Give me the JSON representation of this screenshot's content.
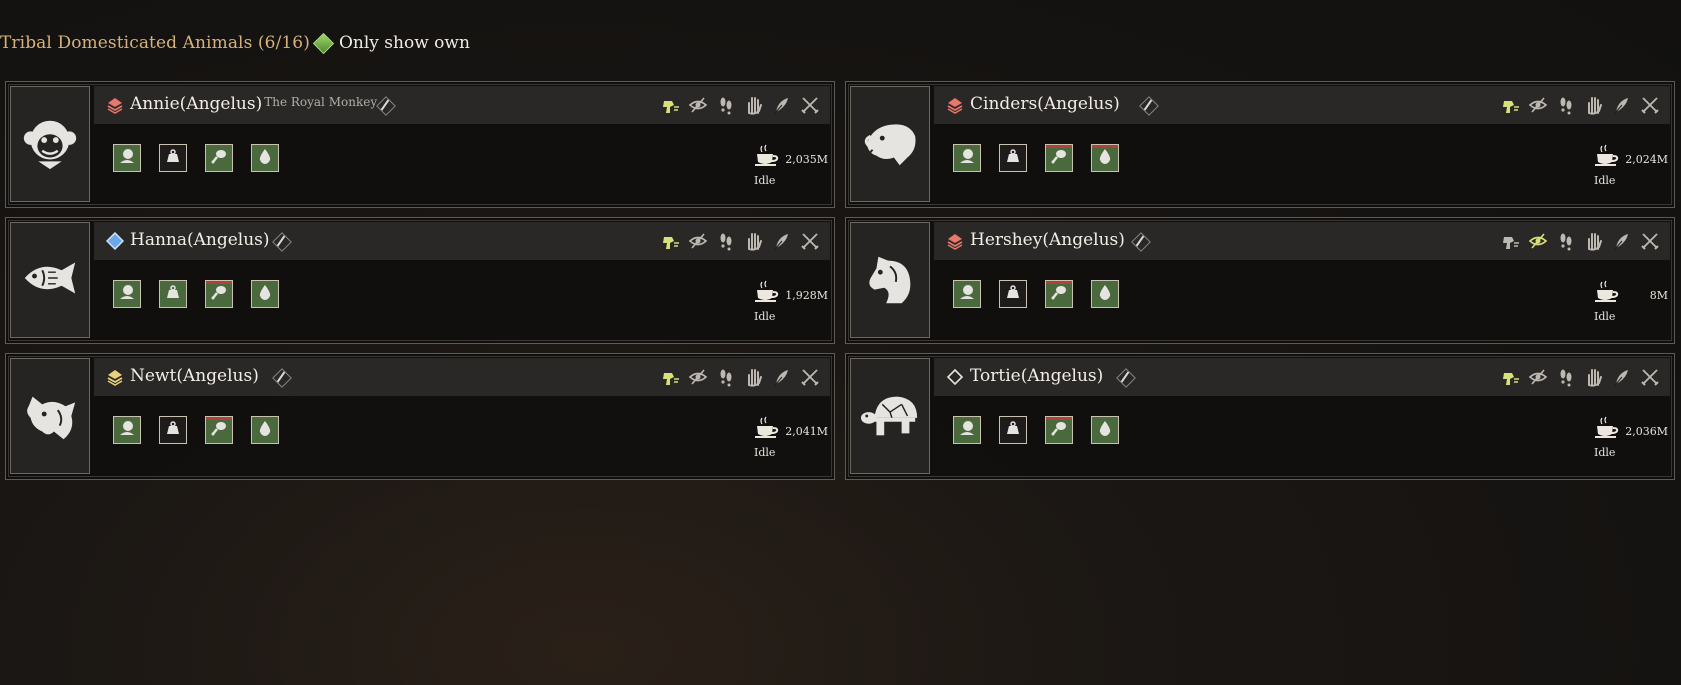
{
  "header": {
    "title": "Tribal Domesticated Animals (6/16)",
    "filter_label": "Only show own"
  },
  "colors": {
    "active_command": "#d8e07a",
    "inactive_command": "#bdb8b0",
    "slot_green": "#4a6a3e",
    "accent_gold": "#d6b27a"
  },
  "animals": [
    {
      "name": "Annie(Angelus)",
      "subtitle": "The Royal Monkey",
      "rank": "red-layers",
      "portrait": "monkey-icon",
      "distance": "2,035M",
      "state": "Idle",
      "active_command": 0
    },
    {
      "name": "Cinders(Angelus)",
      "subtitle": "",
      "rank": "red-layers",
      "portrait": "boar-icon",
      "distance": "2,024M",
      "state": "Idle",
      "active_command": 0
    },
    {
      "name": "Hanna(Angelus)",
      "subtitle": "",
      "rank": "blue-diamond",
      "portrait": "fish-icon",
      "distance": "1,928M",
      "state": "Idle",
      "active_command": 0
    },
    {
      "name": "Hershey(Angelus)",
      "subtitle": "",
      "rank": "red-layers",
      "portrait": "horse-icon",
      "distance": "8M",
      "state": "Idle",
      "active_command": 1
    },
    {
      "name": "Newt(Angelus)",
      "subtitle": "",
      "rank": "gold-layers",
      "portrait": "wolf-icon",
      "distance": "2,041M",
      "state": "Idle",
      "active_command": 0
    },
    {
      "name": "Tortie(Angelus)",
      "subtitle": "",
      "rank": "white-diamond",
      "portrait": "turtle-icon",
      "distance": "2,036M",
      "state": "Idle",
      "active_command": 0
    }
  ],
  "commands": [
    "follow-command-icon",
    "passive-command-icon",
    "stay-command-icon",
    "stop-command-icon",
    "gather-command-icon",
    "attack-command-icon"
  ],
  "slots": [
    "food-slot-icon",
    "weight-slot-icon",
    "meat-slot-icon",
    "water-slot-icon"
  ]
}
